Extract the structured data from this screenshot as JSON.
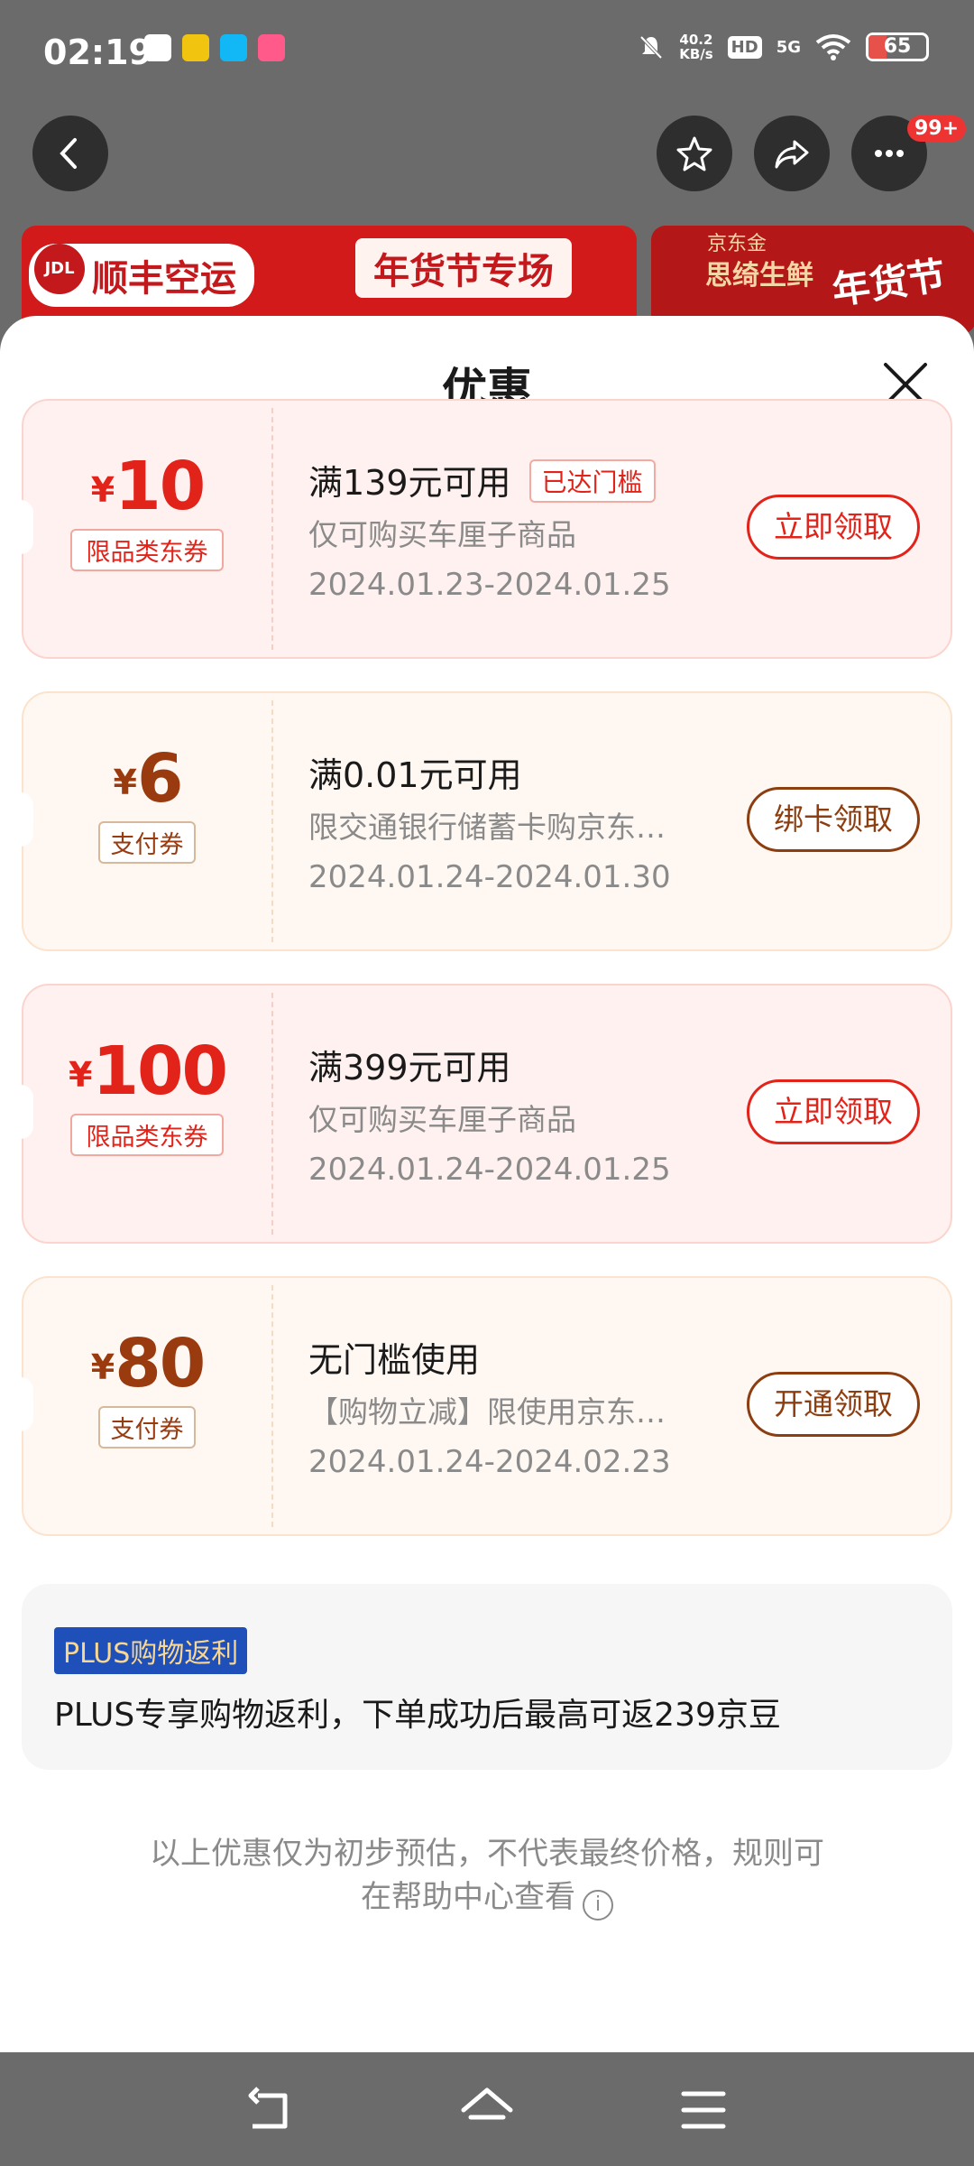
{
  "status": {
    "time": "02:19",
    "speed_value": "40.2",
    "speed_unit": "KB/s",
    "hd": "HD",
    "net": "5G",
    "battery": "65"
  },
  "nav": {
    "badge": "99+"
  },
  "banners": {
    "b1_brand": "顺丰空运",
    "b1_logo": "JDL",
    "b1_title": "年货节专场",
    "b2_line1": "京东金",
    "b2_line2": "思绮生鲜",
    "b2_title": "年货节"
  },
  "sheet": {
    "title": "优惠"
  },
  "coupons": [
    {
      "currency": "¥",
      "amount": "10",
      "tag": "限品类东券",
      "title": "满139元可用",
      "reached": "已达门槛",
      "desc": "仅可购买车厘子商品",
      "date": "2024.01.23-2024.01.25",
      "button": "立即领取",
      "theme": "red"
    },
    {
      "currency": "¥",
      "amount": "6",
      "tag": "支付券",
      "title": "满0.01元可用",
      "desc": "限交通银行储蓄卡购京东…",
      "date": "2024.01.24-2024.01.30",
      "button": "绑卡领取",
      "theme": "gold"
    },
    {
      "currency": "¥",
      "amount": "100",
      "tag": "限品类东券",
      "title": "满399元可用",
      "desc": "仅可购买车厘子商品",
      "date": "2024.01.24-2024.01.25",
      "button": "立即领取",
      "theme": "red"
    },
    {
      "currency": "¥",
      "amount": "80",
      "tag": "支付券",
      "title": "无门槛使用",
      "desc": "【购物立减】限使用京东…",
      "date": "2024.01.24-2024.02.23",
      "button": "开通领取",
      "theme": "gold"
    }
  ],
  "plus": {
    "tag": "PLUS购物返利",
    "text": "PLUS专享购物返利，下单成功后最高可返239京豆"
  },
  "note": {
    "line1": "以上优惠仅为初步预估，不代表最终价格，规则可",
    "line2": "在帮助中心查看"
  },
  "colors": {
    "red": "#e2231a",
    "gold": "#9a3a0f",
    "plus_blue": "#1f4fb8"
  }
}
